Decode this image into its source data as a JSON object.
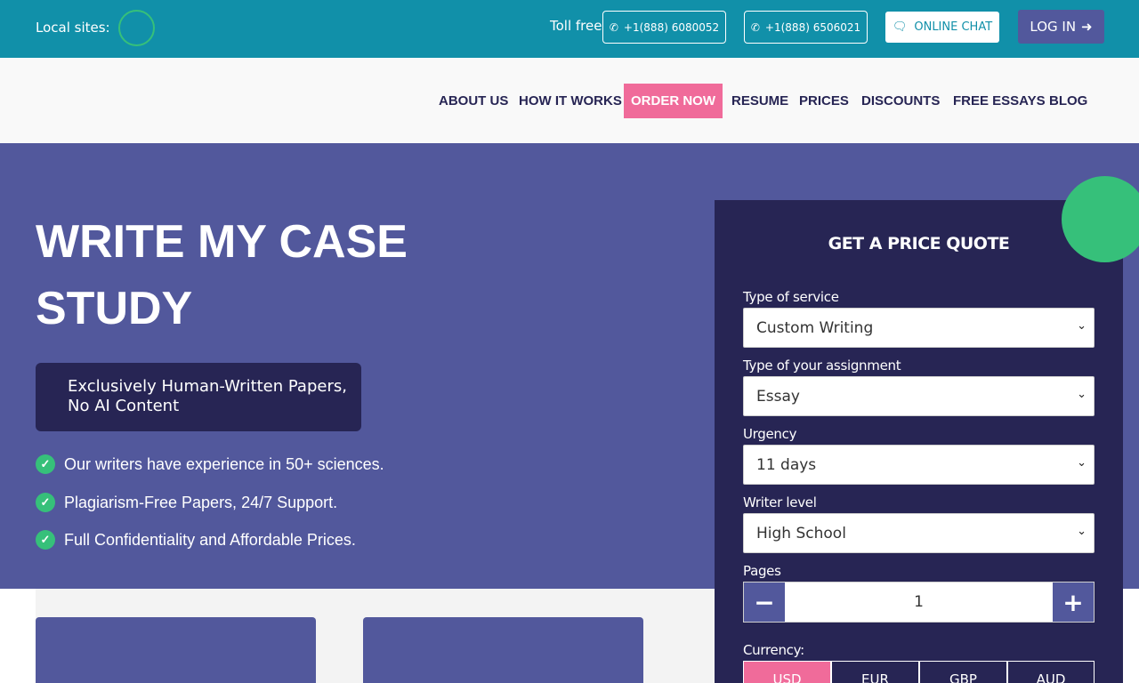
{
  "topbar": {
    "local_sites_label": "Local sites:",
    "toll_free_label": "Toll free",
    "phone1": "+1(888) 6080052",
    "phone2": "+1(888) 6506021",
    "online_chat": "ONLINE CHAT",
    "login": "LOG IN"
  },
  "nav": {
    "items": [
      "ABOUT US",
      "HOW IT WORKS",
      "ORDER NOW",
      "RESUME",
      "PRICES",
      "DISCOUNTS",
      "FREE ESSAYS",
      "BLOG"
    ]
  },
  "hero": {
    "title": "WRITE MY CASE STUDY",
    "badge_line1": "Exclusively Human-Written Papers,",
    "badge_line2": "No AI Content",
    "features": [
      "Our writers have experience in 50+ sciences.",
      "Plagiarism-Free Papers, 24/7 Support.",
      "Full Confidentiality and Affordable Prices."
    ]
  },
  "quote": {
    "title": "GET A PRICE QUOTE",
    "service_label": "Type of service",
    "service_value": "Custom Writing",
    "assignment_label": "Type of your assignment",
    "assignment_value": "Essay",
    "urgency_label": "Urgency",
    "urgency_value": "11 days",
    "level_label": "Writer level",
    "level_value": "High School",
    "pages_label": "Pages",
    "pages_value": "1",
    "currency_label": "Currency:",
    "currencies": [
      "USD",
      "EUR",
      "GBP",
      "AUD"
    ],
    "selected_currency": "USD"
  },
  "colors": {
    "topbar": "#1190a9",
    "hero": "#52589c",
    "dark": "#272554",
    "accent_pink": "#f06b9a",
    "accent_green": "#36c07a"
  },
  "icons": {
    "phone": "phone-icon",
    "chat": "chat-bubble-icon",
    "login": "sign-in-icon",
    "check": "check-circle-icon",
    "chevron": "chevron-down-icon",
    "minus": "minus-icon",
    "plus": "plus-icon"
  }
}
